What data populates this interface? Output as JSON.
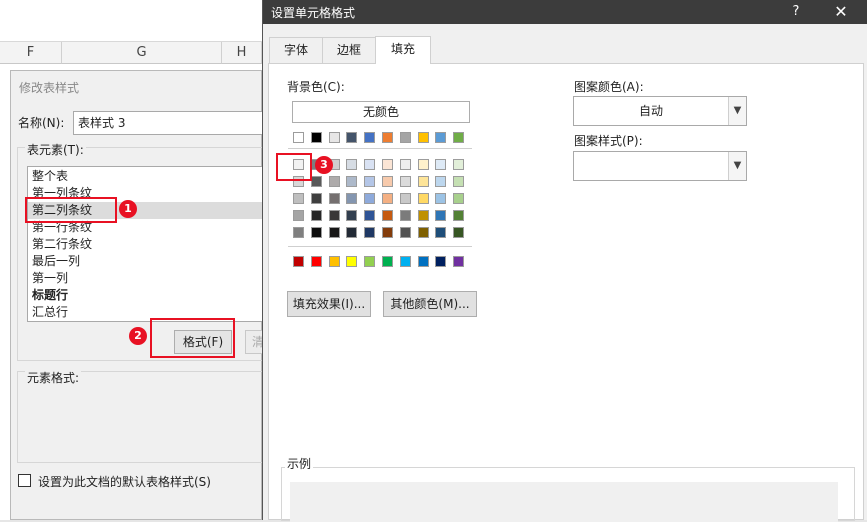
{
  "excel": {
    "columns": [
      "F",
      "G",
      "H"
    ]
  },
  "modify_dialog": {
    "title": "修改表样式",
    "name_label": "名称(N):",
    "name_value": "表样式 3",
    "element_label": "表元素(T):",
    "elements": [
      "整个表",
      "第一列条纹",
      "第二列条纹",
      "第一行条纹",
      "第二行条纹",
      "最后一列",
      "第一列",
      "标题行",
      "汇总行"
    ],
    "selected_element": "第二列条纹",
    "format_button": "格式(F)",
    "clear_button": "清",
    "element_format_label": "元素格式:",
    "default_checkbox_label": "设置为此文档的默认表格样式(S)"
  },
  "format_dialog": {
    "title": "设置单元格格式",
    "help": "?",
    "close": "✕",
    "tabs": [
      "字体",
      "边框",
      "填充"
    ],
    "active_tab": "填充",
    "bg_color_label": "背景色(C):",
    "no_color": "无颜色",
    "fill_effects_button": "填充效果(I)...",
    "more_colors_button": "其他颜色(M)...",
    "pattern_color_label": "图案颜色(A):",
    "pattern_color_value": "自动",
    "pattern_style_label": "图案样式(P):",
    "sample_label": "示例",
    "theme_top_row": [
      "#ffffff",
      "#000000",
      "#e7e6e6",
      "#44546a",
      "#4472c4",
      "#ed7d31",
      "#a5a5a5",
      "#ffc000",
      "#5b9bd5",
      "#70ad47"
    ],
    "theme_tints": [
      [
        "#f2f2f2",
        "#7f7f7f",
        "#d0cece",
        "#d6dce4",
        "#d9e2f3",
        "#fbe5d5",
        "#ededed",
        "#fff2cc",
        "#deeaf6",
        "#e2efd9"
      ],
      [
        "#d8d8d8",
        "#595959",
        "#aeabab",
        "#adb9ca",
        "#b4c6e7",
        "#f7caac",
        "#dbdbdb",
        "#fee599",
        "#bdd7ee",
        "#c5e0b3"
      ],
      [
        "#bfbfbf",
        "#3f3f3f",
        "#757070",
        "#8496b0",
        "#8eaadb",
        "#f4b083",
        "#c9c9c9",
        "#ffd965",
        "#9cc3e5",
        "#a8d08d"
      ],
      [
        "#a5a5a5",
        "#262626",
        "#3a3838",
        "#323f4f",
        "#2f5496",
        "#c55a11",
        "#7b7b7b",
        "#bf9000",
        "#2e75b5",
        "#538135"
      ],
      [
        "#7f7f7f",
        "#0c0c0c",
        "#171616",
        "#222a35",
        "#1f3864",
        "#833c0b",
        "#525252",
        "#7f6000",
        "#1e4e79",
        "#375623"
      ]
    ],
    "standard_colors": [
      "#c00000",
      "#ff0000",
      "#ffc000",
      "#ffff00",
      "#92d050",
      "#00b050",
      "#00b0f0",
      "#0070c0",
      "#002060",
      "#7030a0"
    ]
  },
  "annotations": {
    "badge_1": "1",
    "badge_2": "2",
    "badge_3": "3",
    "highlight_color": "#e81123"
  }
}
